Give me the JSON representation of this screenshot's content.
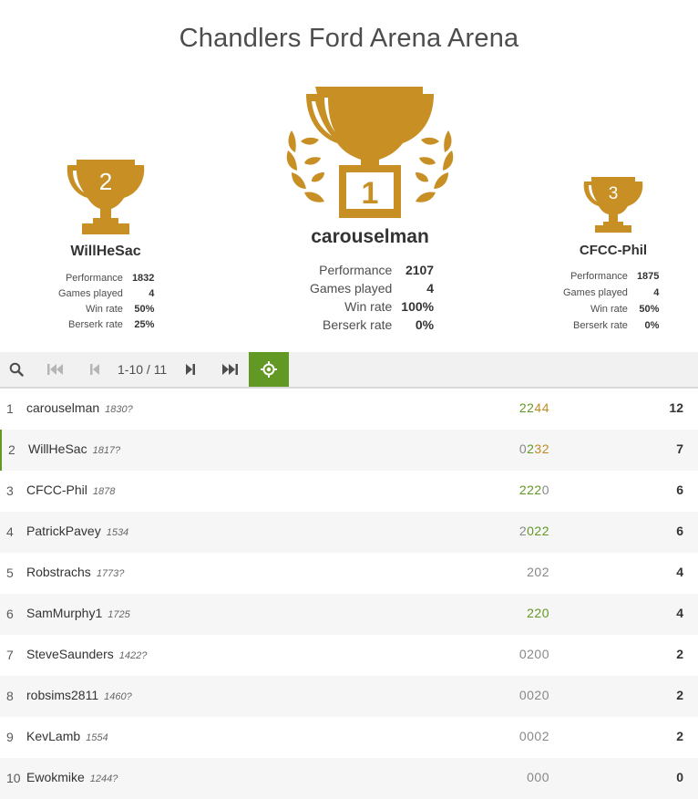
{
  "title": "Chandlers Ford Arena Arena",
  "podium": {
    "first": {
      "rank": "1",
      "name": "carouselman",
      "perf": "2107",
      "games": "4",
      "win": "100%",
      "berserk": "0%"
    },
    "second": {
      "rank": "2",
      "name": "WillHeSac",
      "perf": "1832",
      "games": "4",
      "win": "50%",
      "berserk": "25%"
    },
    "third": {
      "rank": "3",
      "name": "CFCC-Phil",
      "perf": "1875",
      "games": "4",
      "win": "50%",
      "berserk": "0%"
    },
    "labels": {
      "perf": "Performance",
      "games": "Games played",
      "win": "Win rate",
      "berserk": "Berserk rate"
    }
  },
  "toolbar": {
    "pager": "1-10 / 11"
  },
  "standings": [
    {
      "rank": "1",
      "name": "carouselman",
      "rating": "1830?",
      "sheet": [
        [
          "22",
          "g"
        ],
        [
          "44",
          "o"
        ]
      ],
      "score": "12"
    },
    {
      "rank": "2",
      "name": "WillHeSac",
      "rating": "1817?",
      "sheet": [
        [
          "0",
          "n"
        ],
        [
          "2",
          "g"
        ],
        [
          "32",
          "o"
        ]
      ],
      "score": "7"
    },
    {
      "rank": "3",
      "name": "CFCC-Phil",
      "rating": "1878",
      "sheet": [
        [
          "222",
          "g"
        ],
        [
          "0",
          "n"
        ]
      ],
      "score": "6"
    },
    {
      "rank": "4",
      "name": "PatrickPavey",
      "rating": "1534",
      "sheet": [
        [
          "2",
          "n"
        ],
        [
          "022",
          "g"
        ]
      ],
      "score": "6"
    },
    {
      "rank": "5",
      "name": "Robstrachs",
      "rating": "1773?",
      "sheet": [
        [
          "202",
          "n"
        ]
      ],
      "score": "4"
    },
    {
      "rank": "6",
      "name": "SamMurphy1",
      "rating": "1725",
      "sheet": [
        [
          "220",
          "g"
        ]
      ],
      "score": "4"
    },
    {
      "rank": "7",
      "name": "SteveSaunders",
      "rating": "1422?",
      "sheet": [
        [
          "0200",
          "n"
        ]
      ],
      "score": "2"
    },
    {
      "rank": "8",
      "name": "robsims2811",
      "rating": "1460?",
      "sheet": [
        [
          "0020",
          "n"
        ]
      ],
      "score": "2"
    },
    {
      "rank": "9",
      "name": "KevLamb",
      "rating": "1554",
      "sheet": [
        [
          "0002",
          "n"
        ]
      ],
      "score": "2"
    },
    {
      "rank": "10",
      "name": "Ewokmike",
      "rating": "1244?",
      "sheet": [
        [
          "000",
          "n"
        ]
      ],
      "score": "0"
    }
  ]
}
